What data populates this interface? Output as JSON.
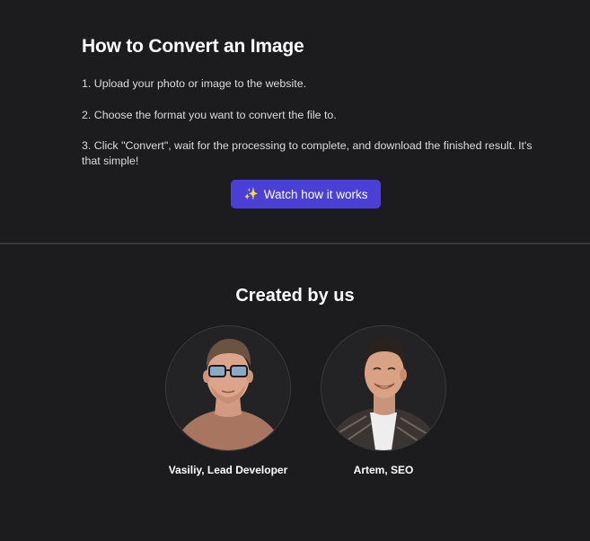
{
  "howto": {
    "title": "How to Convert an Image",
    "steps": [
      "1. Upload your photo or image to the website.",
      "2. Choose the format you want to convert the file to.",
      "3. Click \"Convert\", wait for the processing to complete, and download the finished result. It's that simple!"
    ],
    "button": {
      "icon": "sparkles-icon",
      "icon_glyph": "✨",
      "label": "Watch how it works",
      "color": "#4a3fd6"
    }
  },
  "team": {
    "title": "Created by us",
    "members": [
      {
        "name": "Vasiliy, Lead Developer"
      },
      {
        "name": "Artem, SEO"
      }
    ]
  },
  "colors": {
    "background": "#1c1c1e",
    "divider": "#3a3a3d",
    "accent": "#4a3fd6"
  }
}
